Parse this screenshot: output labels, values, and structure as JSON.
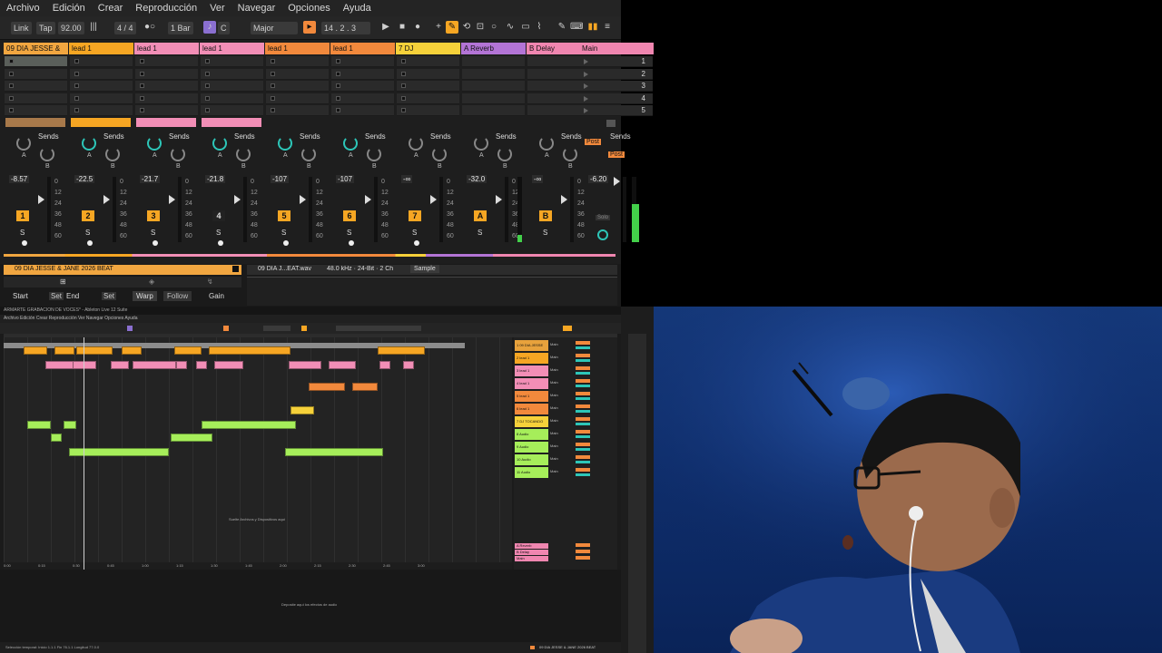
{
  "menu": [
    "Archivo",
    "Edición",
    "Crear",
    "Reproducción",
    "Ver",
    "Navegar",
    "Opciones",
    "Ayuda"
  ],
  "transport": {
    "link": "Link",
    "tap": "Tap",
    "tempo": "92.00",
    "signature": "4 / 4",
    "quantize": "1 Bar",
    "key": "C",
    "scale": "Major",
    "position": "14 .  2 .  3"
  },
  "tracks": [
    {
      "name": "09 DIA JESSE &",
      "color": "#f1a640",
      "num": "1",
      "vol": "-8.57",
      "clip": "#a8794a",
      "sends_on": false
    },
    {
      "name": "lead 1",
      "color": "#f6a623",
      "num": "2",
      "vol": "-22.5",
      "clip": "#f6a623",
      "sends_on": true
    },
    {
      "name": "lead 1",
      "color": "#f28eb6",
      "num": "3",
      "vol": "-21.7",
      "clip": "#f28eb6",
      "sends_on": true
    },
    {
      "name": "lead 1",
      "color": "#f28eb6",
      "num": "4",
      "vol": "-21.8",
      "clip": "#f28eb6",
      "sends_on": true
    },
    {
      "name": "lead 1",
      "color": "#f2893c",
      "num": "5",
      "vol": "-107",
      "clip": "",
      "sends_on": true
    },
    {
      "name": "lead 1",
      "color": "#f2893c",
      "num": "6",
      "vol": "-107",
      "clip": "",
      "sends_on": true
    },
    {
      "name": "7 DJ",
      "color": "#f6d13a",
      "num": "7",
      "vol": "-∞",
      "clip": "",
      "sends_on": false
    }
  ],
  "returns": [
    {
      "name": "A Reverb",
      "color": "#b374d6",
      "num": "A",
      "vol": "-32.0"
    },
    {
      "name": "B Delay",
      "color": "#f086b0",
      "num": "B",
      "vol": "-∞"
    }
  ],
  "main": {
    "name": "Main",
    "color": "#f086b0",
    "vol": "-6.20",
    "scenes": [
      "1",
      "2",
      "3",
      "4",
      "5"
    ],
    "post": "Post",
    "solo": "Solo"
  },
  "sends_label": "Sends",
  "knob_a": "A",
  "knob_b": "B",
  "s_label": "S",
  "meter_scale": [
    "0",
    "12",
    "24",
    "36",
    "48",
    "60"
  ],
  "clip_view": {
    "track_name": "09 DIA JESSE & JANE 2026 BEAT",
    "file": "09 DIA J...EAT.wav",
    "info": "48.0 kHz · 24-Bit · 2 Ch",
    "sample_tab": "Sample",
    "start": "Start",
    "set": "Set",
    "end": "End",
    "set2": "Set",
    "warp": "Warp",
    "follow": "Follow",
    "gain": "Gain"
  },
  "arrangement": {
    "title": "ARMARTE GRABACION DE VOCES* - Ableton Live 12 Suite",
    "menu": "Archivo   Edición   Crear   Reproducción   Ver   Navegar   Opciones   Ayuda",
    "drop_hint": "Suelte Archivos y Dispositivos aquí",
    "fx_hint": "Deposite aquí los efectos de audio",
    "status": "Selección temporal: Inicio 1.1.1    Fin 76.1.1    Longitud 77.0.0",
    "bottom_track": "09 DIA JESSE & JANE 2026 BEAT",
    "times": [
      "0:00",
      "0:15",
      "0:30",
      "0:45",
      "1:00",
      "1:15",
      "1:30",
      "1:45",
      "2:00",
      "2:15",
      "2:30",
      "2:45",
      "3:00"
    ],
    "mixer_rows": [
      {
        "name": "1 09 DIA JESSE",
        "color": "#e8a23c"
      },
      {
        "name": "2 lead 1",
        "color": "#f6a623"
      },
      {
        "name": "3 lead 1",
        "color": "#f28eb6"
      },
      {
        "name": "4 lead 1",
        "color": "#f28eb6"
      },
      {
        "name": "5 lead 1",
        "color": "#f2893c"
      },
      {
        "name": "6 lead 1",
        "color": "#f2893c"
      },
      {
        "name": "7 DJ TOCANDO",
        "color": "#f6d13a"
      },
      {
        "name": "8 Audio",
        "color": "#a6ee5a"
      },
      {
        "name": "9 Audio",
        "color": "#a6ee5a"
      },
      {
        "name": "10 Audio",
        "color": "#a6ee5a"
      },
      {
        "name": "11 Audio",
        "color": "#a6ee5a"
      }
    ],
    "mixer_main": "Main",
    "return_rows": [
      {
        "name": "A Reverb",
        "color": "#f086b0"
      },
      {
        "name": "B Delay",
        "color": "#f086b0"
      },
      {
        "name": "Main",
        "color": "#f086b0"
      }
    ]
  },
  "colors": {
    "session_bg": "#1e1e1e",
    "accent": "#f2893c",
    "meter_green": "#43d04a"
  }
}
